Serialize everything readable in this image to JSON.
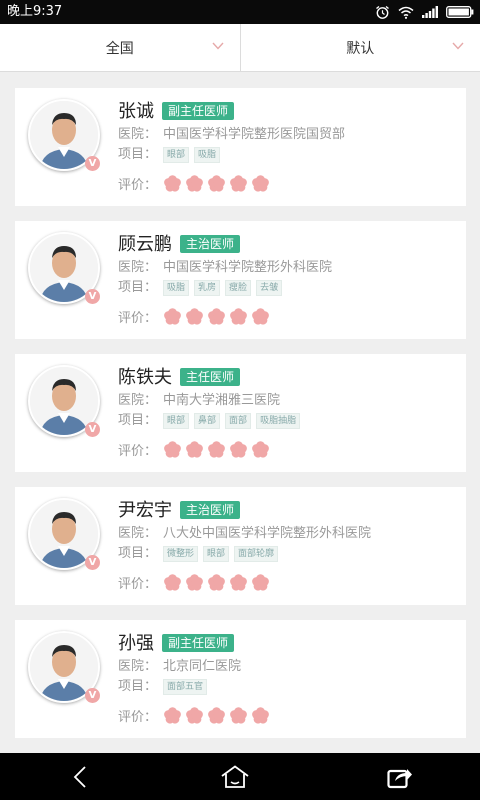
{
  "status_bar": {
    "time": "晚上9:37",
    "icons": [
      "alarm-icon",
      "wifi-icon",
      "signal-icon",
      "battery-icon"
    ]
  },
  "filters": {
    "region": "全国",
    "sort": "默认"
  },
  "labels": {
    "hospital": "医院：",
    "projects": "项目：",
    "rating": "评价："
  },
  "doctors": [
    {
      "name": "张诚",
      "title": "副主任医师",
      "hospital": "中国医学科学院整形医院国贸部",
      "tags": [
        "眼部",
        "吸脂"
      ],
      "rating": 5
    },
    {
      "name": "顾云鹏",
      "title": "主治医师",
      "hospital": "中国医学科学院整形外科医院",
      "tags": [
        "吸脂",
        "乳房",
        "瘦脸",
        "去皱"
      ],
      "rating": 5
    },
    {
      "name": "陈铁夫",
      "title": "主任医师",
      "hospital": "中南大学湘雅三医院",
      "tags": [
        "眼部",
        "鼻部",
        "面部",
        "吸脂抽脂"
      ],
      "rating": 5
    },
    {
      "name": "尹宏宇",
      "title": "主治医师",
      "hospital": "八大处中国医学科学院整形外科医院",
      "tags": [
        "微整形",
        "眼部",
        "面部轮廓"
      ],
      "rating": 5
    },
    {
      "name": "孙强",
      "title": "副主任医师",
      "hospital": "北京同仁医院",
      "tags": [
        "面部五官"
      ],
      "rating": 5
    }
  ],
  "badge_text": "V",
  "colors": {
    "accent_green": "#3cb28a",
    "star_pink": "#f0a7a7",
    "background": "#efefef"
  },
  "nav": [
    "back-icon",
    "home-icon",
    "share-icon"
  ]
}
